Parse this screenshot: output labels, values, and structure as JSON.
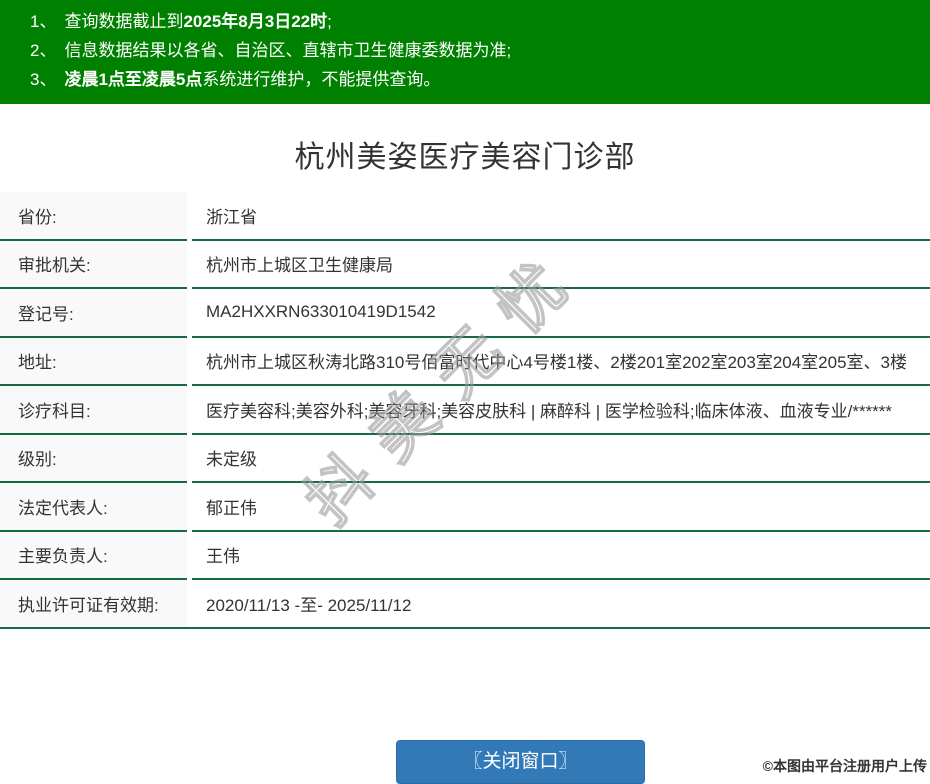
{
  "banner": {
    "notices": [
      {
        "num": "1、",
        "pre": "查询数据截止到",
        "bold": "2025年8月3日22时",
        "post": ";"
      },
      {
        "num": "2、",
        "pre": "信息数据结果以各省、自治区、直辖市卫生健康委数据为准;",
        "bold": "",
        "post": ""
      },
      {
        "num": "3、",
        "pre": "",
        "bold": "凌晨1点至凌晨5点",
        "post": "系统进行维护，不能提供查询。"
      }
    ]
  },
  "page": {
    "title": "杭州美姿医疗美容门诊部"
  },
  "table": {
    "rows": [
      {
        "label": "省份:",
        "value": "浙江省"
      },
      {
        "label": "审批机关:",
        "value": "杭州市上城区卫生健康局"
      },
      {
        "label": "登记号:",
        "value": "MA2HXXRN633010419D1542"
      },
      {
        "label": "地址:",
        "value": "杭州市上城区秋涛北路310号佰富时代中心4号楼1楼、2楼201室202室203室204室205室、3楼"
      },
      {
        "label": "诊疗科目:",
        "value": "医疗美容科;美容外科;美容牙科;美容皮肤科 | 麻醉科 | 医学检验科;临床体液、血液专业/******"
      },
      {
        "label": "级别:",
        "value": "未定级"
      },
      {
        "label": "法定代表人:",
        "value": "郁正伟"
      },
      {
        "label": "主要负责人:",
        "value": "王伟"
      },
      {
        "label": "执业许可证有效期:",
        "value": "2020/11/13 -至- 2025/11/12"
      }
    ]
  },
  "watermark": {
    "text": "抖美无忧"
  },
  "footer": {
    "close_button": "〖关闭窗口〗",
    "copyright": "©本图由平台注册用户上传"
  },
  "colors": {
    "banner_green": "#008000",
    "border_green": "#17693f",
    "label_bg": "#f9f9f9",
    "button_blue": "#3279b7",
    "text": "#333333"
  }
}
